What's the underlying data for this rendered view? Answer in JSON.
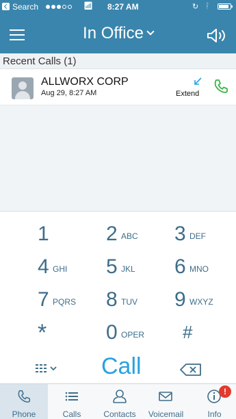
{
  "status_bar": {
    "back_app": "Search",
    "time": "8:27 AM"
  },
  "nav": {
    "title": "In Office"
  },
  "recent": {
    "header": "Recent Calls (1)",
    "calls": [
      {
        "name": "ALLWORX CORP",
        "time": "Aug 29, 8:27 AM",
        "action_label": "Extend"
      }
    ]
  },
  "keypad": {
    "keys": [
      {
        "digit": "1",
        "letters": ""
      },
      {
        "digit": "2",
        "letters": "ABC"
      },
      {
        "digit": "3",
        "letters": "DEF"
      },
      {
        "digit": "4",
        "letters": "GHI"
      },
      {
        "digit": "5",
        "letters": "JKL"
      },
      {
        "digit": "6",
        "letters": "MNO"
      },
      {
        "digit": "7",
        "letters": "PQRS"
      },
      {
        "digit": "8",
        "letters": "TUV"
      },
      {
        "digit": "9",
        "letters": "WXYZ"
      },
      {
        "digit": "*",
        "letters": ""
      },
      {
        "digit": "0",
        "letters": "OPER"
      },
      {
        "digit": "#",
        "letters": ""
      }
    ],
    "call_label": "Call"
  },
  "tabs": [
    {
      "label": "Phone",
      "icon": "phone-icon",
      "active": true
    },
    {
      "label": "Calls",
      "icon": "list-icon"
    },
    {
      "label": "Contacts",
      "icon": "contacts-icon"
    },
    {
      "label": "Voicemail",
      "icon": "envelope-icon"
    },
    {
      "label": "Info",
      "icon": "info-icon",
      "badge": "!"
    }
  ],
  "colors": {
    "header_blue": "#3a85ad",
    "accent_green": "#3ab44a",
    "call_blue": "#29a2e0",
    "badge_red": "#e23b2e"
  }
}
